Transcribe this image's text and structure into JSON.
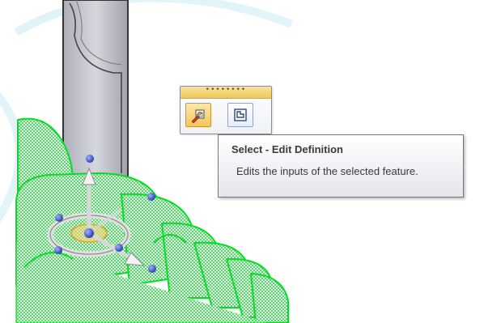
{
  "mini_toolbar": {
    "grip_text": "••••••••",
    "buttons": [
      {
        "icon": "select-edit-definition-icon",
        "state": "highlighted"
      },
      {
        "icon": "edit-profile-icon",
        "state": "normal"
      }
    ]
  },
  "tooltip": {
    "title": "Select - Edit Definition",
    "description": "Edits the inputs of the selected feature."
  },
  "colors": {
    "part_gray": "#c8c8cf",
    "selection_green": "#00ff22",
    "handle_blue": "#3a4fc7",
    "highlight_orange": "#f5a623"
  }
}
